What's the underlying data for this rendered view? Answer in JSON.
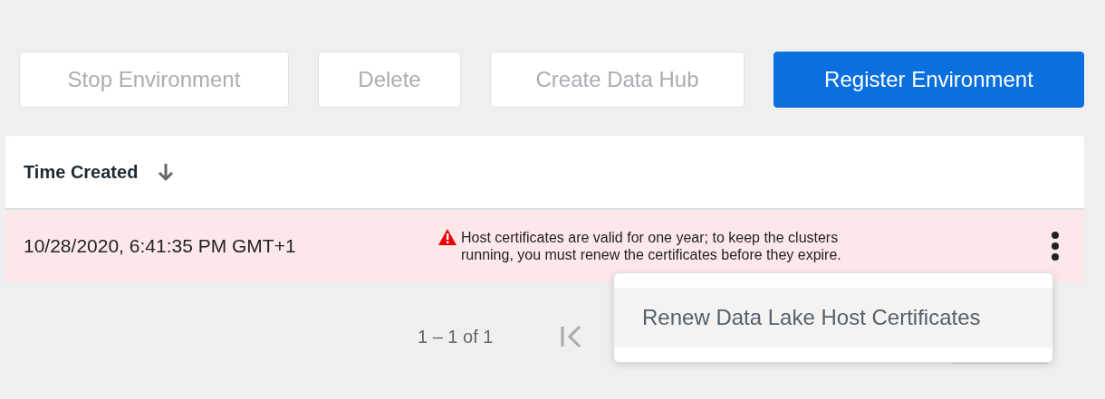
{
  "toolbar": {
    "buttons": [
      {
        "label": "Stop Environment",
        "disabled": true
      },
      {
        "label": "Delete",
        "disabled": true
      },
      {
        "label": "Create Data Hub",
        "disabled": true
      },
      {
        "label": "Register Environment",
        "disabled": false
      }
    ]
  },
  "table": {
    "columns": [
      {
        "label": "Time Created",
        "sort_descending": true
      }
    ],
    "rows": [
      {
        "time_created": "10/28/2020, 6:41:35 PM GMT+1",
        "warning": "Host certificates are valid for one year; to keep the clusters running, you must renew the certificates before they expire.",
        "highlighted": true
      }
    ]
  },
  "pagination": {
    "range": "1 – 1 of 1"
  },
  "menu": {
    "items": [
      {
        "label": "Renew Data Lake Host Certificates",
        "selected": true
      }
    ]
  }
}
